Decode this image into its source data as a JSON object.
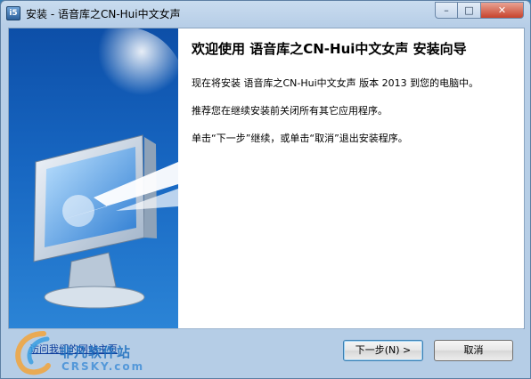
{
  "window": {
    "title": "安装 - 语音库之CN-Hui中文女声",
    "icon_text": "i5",
    "controls": {
      "minimize": "–",
      "maximize": "□",
      "close": "✕"
    }
  },
  "wizard": {
    "heading": "欢迎使用 语音库之CN-Hui中文女声 安装向导",
    "line1": "现在将安装 语音库之CN-Hui中文女声 版本 2013 到您的电脑中。",
    "line2": "推荐您在继续安装前关闭所有其它应用程序。",
    "line3": "单击“下一步”继续，或单击“取消”退出安装程序。"
  },
  "footer": {
    "link_label": "访问我们的网站主页",
    "next_label": "下一步(N) >",
    "cancel_label": "取消"
  },
  "watermark": {
    "line1": "非凡软件站",
    "line2": "CRSKY.com"
  }
}
